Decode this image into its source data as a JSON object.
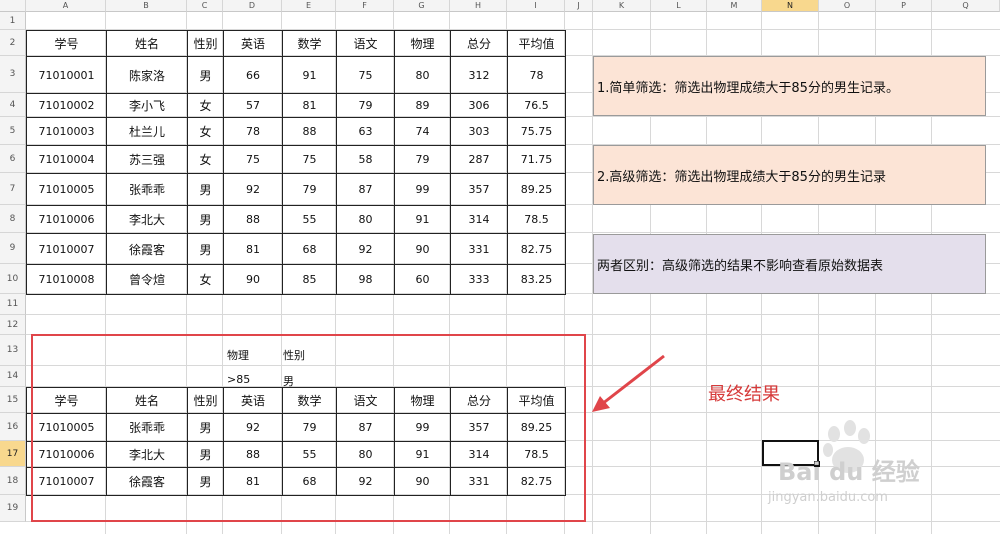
{
  "sheet": {
    "columns": [
      "A",
      "B",
      "C",
      "D",
      "E",
      "F",
      "G",
      "H",
      "I",
      "J",
      "K",
      "L",
      "M",
      "N",
      "O",
      "P",
      "Q"
    ],
    "selected_column": "N",
    "rows": [
      "1",
      "2",
      "3",
      "4",
      "5",
      "6",
      "7",
      "8",
      "9",
      "10",
      "11",
      "12",
      "13",
      "14",
      "15",
      "16",
      "17",
      "18",
      "19"
    ],
    "selected_row": "17"
  },
  "main_table": {
    "headers": [
      "学号",
      "姓名",
      "性别",
      "英语",
      "数学",
      "语文",
      "物理",
      "总分",
      "平均值"
    ],
    "rows": [
      [
        "71010001",
        "陈家洛",
        "男",
        "66",
        "91",
        "75",
        "80",
        "312",
        "78"
      ],
      [
        "71010002",
        "李小飞",
        "女",
        "57",
        "81",
        "79",
        "89",
        "306",
        "76.5"
      ],
      [
        "71010003",
        "杜兰儿",
        "女",
        "78",
        "88",
        "63",
        "74",
        "303",
        "75.75"
      ],
      [
        "71010004",
        "苏三强",
        "女",
        "75",
        "75",
        "58",
        "79",
        "287",
        "71.75"
      ],
      [
        "71010005",
        "张乖乖",
        "男",
        "92",
        "79",
        "87",
        "99",
        "357",
        "89.25"
      ],
      [
        "71010006",
        "李北大",
        "男",
        "88",
        "55",
        "80",
        "91",
        "314",
        "78.5"
      ],
      [
        "71010007",
        "徐霞客",
        "男",
        "81",
        "68",
        "92",
        "90",
        "331",
        "82.75"
      ],
      [
        "71010008",
        "曾令煊",
        "女",
        "90",
        "85",
        "98",
        "60",
        "333",
        "83.25"
      ]
    ]
  },
  "criteria": {
    "h1": "物理",
    "h2": "性别",
    "v1": ">85",
    "v2": "男"
  },
  "result_table": {
    "headers": [
      "学号",
      "姓名",
      "性别",
      "英语",
      "数学",
      "语文",
      "物理",
      "总分",
      "平均值"
    ],
    "rows": [
      [
        "71010005",
        "张乖乖",
        "男",
        "92",
        "79",
        "87",
        "99",
        "357",
        "89.25"
      ],
      [
        "71010006",
        "李北大",
        "男",
        "88",
        "55",
        "80",
        "91",
        "314",
        "78.5"
      ],
      [
        "71010007",
        "徐霞客",
        "男",
        "81",
        "68",
        "92",
        "90",
        "331",
        "82.75"
      ]
    ]
  },
  "notes": {
    "simple": "1.简单筛选：筛选出物理成绩大于85分的男生记录。",
    "advanced": "2.高级筛选：筛选出物理成绩大于85分的男生记录",
    "difference": "两者区别：高级筛选的结果不影响查看原始数据表"
  },
  "annotation": {
    "final_label": "最终结果"
  },
  "watermark": {
    "brand": "Bai du 经验",
    "url": "jingyan.baidu.com"
  },
  "colors": {
    "note_peach": "#fce4d6",
    "note_purple": "#e4dfec",
    "red": "#e0454a",
    "header_bg": "#f4f4f4",
    "header_selected": "#f8d88e"
  }
}
